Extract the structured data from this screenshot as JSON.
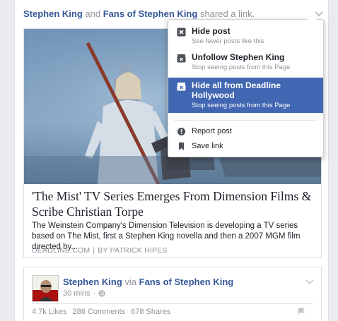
{
  "story": {
    "actor1": "Stephen King",
    "conj": " and ",
    "actor2": "Fans of Stephen King",
    "action": " shared a link."
  },
  "link": {
    "title": "'The Mist' TV Series Emerges From Dimension Films & Scribe Christian Torpe",
    "description": "The Weinstein Company's Dimension Television is developing a TV series based on The Mist, first a Stephen King novella and then a 2007 MGM film directed by...",
    "domain": "DEADLINE.COM",
    "separator": "|",
    "author": "BY PATRICK HIPES"
  },
  "menu": {
    "items": [
      {
        "title": "Hide post",
        "subtitle": "See fewer posts like this",
        "icon": "close-box-icon"
      },
      {
        "title": "Unfollow Stephen King",
        "subtitle": "Stop seeing posts from this Page",
        "icon": "unfollow-icon"
      },
      {
        "title": "Hide all from Deadline Hollywood",
        "subtitle": "Stop seeing posts from this Page",
        "icon": "hide-all-icon",
        "active": true
      },
      {
        "title": "Report post",
        "icon": "report-icon"
      },
      {
        "title": "Save link",
        "icon": "bookmark-icon"
      }
    ]
  },
  "second_story": {
    "actor1": "Stephen King",
    "via": " via ",
    "actor2": "Fans of Stephen King",
    "time": "30 mins",
    "dot": "·",
    "stats": {
      "likes": "4.7k Likes",
      "comments": "286 Comments",
      "shares": "678 Shares"
    }
  },
  "colors": {
    "link_blue": "#365899",
    "menu_active": "#4267b2",
    "meta_gray": "#90949c"
  }
}
